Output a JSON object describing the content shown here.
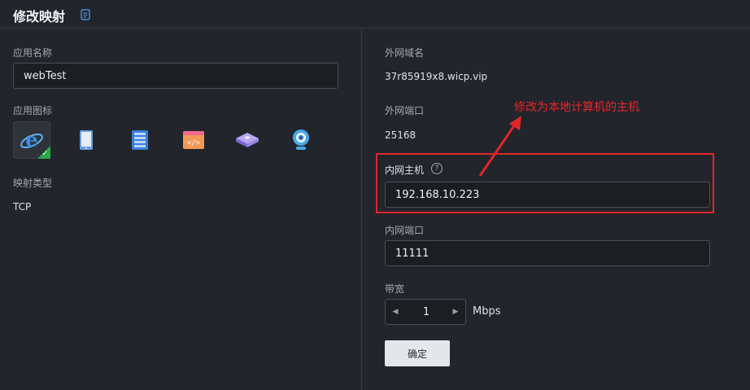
{
  "header": {
    "title": "修改映射",
    "doc_icon": "document-icon"
  },
  "left": {
    "app_name_label": "应用名称",
    "app_name_value": "webTest",
    "app_icon_label": "应用图标",
    "icons": [
      {
        "name": "ie-browser-icon",
        "selected": true
      },
      {
        "name": "tablet-icon",
        "selected": false
      },
      {
        "name": "server-icon",
        "selected": false
      },
      {
        "name": "code-icon",
        "selected": false
      },
      {
        "name": "network-switch-icon",
        "selected": false
      },
      {
        "name": "webcam-icon",
        "selected": false
      }
    ],
    "mapping_type_label": "映射类型",
    "mapping_type_value": "TCP"
  },
  "right": {
    "ext_domain_label": "外网域名",
    "ext_domain_value": "37r85919x8.wicp.vip",
    "ext_port_label": "外网端口",
    "ext_port_value": "25168",
    "int_host_label": "内网主机",
    "int_host_value": "192.168.10.223",
    "int_port_label": "内网端口",
    "int_port_value": "11111",
    "bandwidth_label": "带宽",
    "bandwidth_value": "1",
    "bandwidth_unit": "Mbps",
    "confirm_label": "确定"
  },
  "annotation": {
    "text": "修改为本地计算机的主机",
    "color": "#e8262a"
  },
  "colors": {
    "background": "#22252b",
    "highlight": "#e0262a",
    "selected_check": "#2aa84a"
  }
}
